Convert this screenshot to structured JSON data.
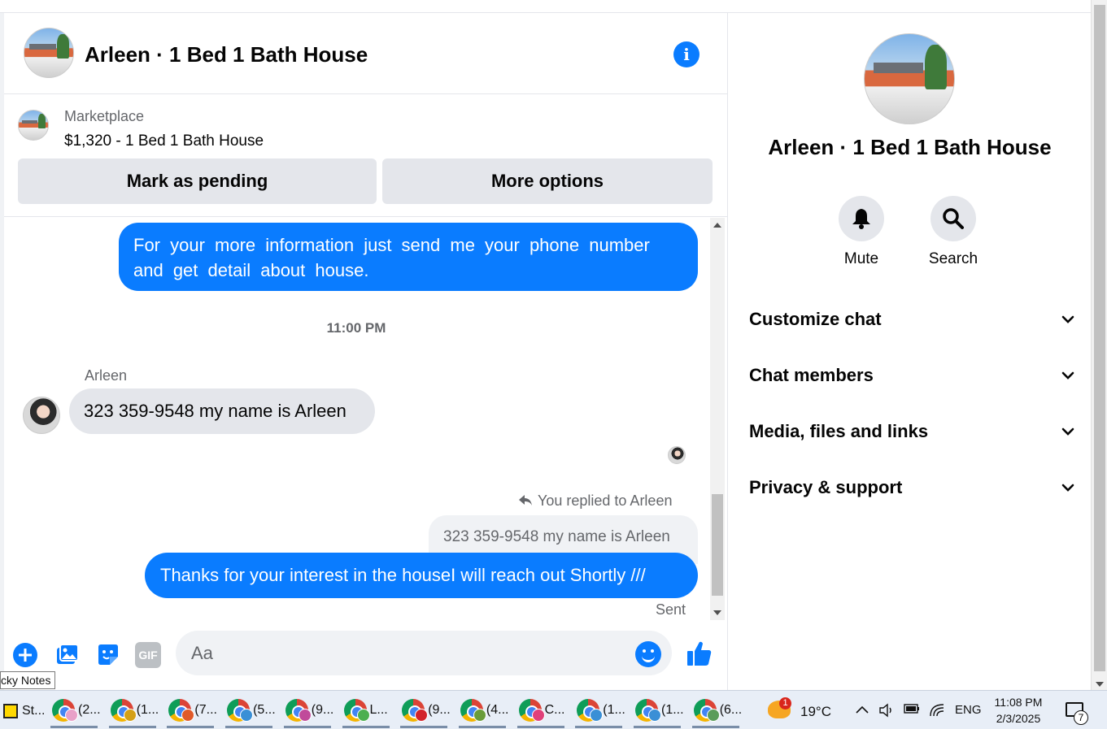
{
  "conversation": {
    "title": "Arleen · 1 Bed 1 Bath House"
  },
  "listing": {
    "label": "Marketplace",
    "title": "$1,320 - 1 Bed 1 Bath House",
    "pending_button": "Mark as pending",
    "more_button": "More options"
  },
  "messages": {
    "outgoing_1": "For your more information just send me  your phone number  and get detail about house.",
    "timestamp": "11:00 PM",
    "sender_name": "Arleen",
    "incoming_1": "323 359-9548 my name is Arleen",
    "reply_note": "You replied to Arleen",
    "quoted_text": "323 359-9548 my name is Arleen",
    "outgoing_2": "Thanks for your interest in the houseI will reach out Shortly ///",
    "status": "Sent"
  },
  "composer": {
    "placeholder": "Aa",
    "gif_label": "GIF"
  },
  "info_panel": {
    "title": "Arleen · 1 Bed 1 Bath House",
    "mute_label": "Mute",
    "search_label": "Search",
    "sections": [
      {
        "label": "Customize chat"
      },
      {
        "label": "Chat members"
      },
      {
        "label": "Media, files and links"
      },
      {
        "label": "Privacy & support"
      }
    ]
  },
  "sticky_tab": "cky Notes",
  "taskbar": {
    "start_label": "St...",
    "items": [
      {
        "label": "(2...",
        "badge": "#e8a0c8"
      },
      {
        "label": "(1...",
        "badge": "#d4a017"
      },
      {
        "label": "(7...",
        "badge": "#e05a2a"
      },
      {
        "label": "(5...",
        "badge": "#3a8fd6"
      },
      {
        "label": "(9...",
        "badge": "#c04a9a"
      },
      {
        "label": "L...",
        "badge": "#4caf50"
      },
      {
        "label": "(9...",
        "badge": "#d2232a"
      },
      {
        "label": "(4...",
        "badge": "#6a9c3a"
      },
      {
        "label": "C...",
        "badge": "#e0407a"
      },
      {
        "label": "(1...",
        "badge": "#3a8fd6"
      },
      {
        "label": "(1...",
        "badge": "#3a8fd6"
      },
      {
        "label": "(6...",
        "badge": "#5a9c5a"
      }
    ],
    "weather_badge": "1",
    "temperature": "19°C",
    "language": "ENG",
    "time": "11:08 PM",
    "date": "2/3/2025",
    "notification_count": "7"
  },
  "colors": {
    "accent": "#0a7cff",
    "bubble_incoming": "#e4e6eb",
    "secondary_text": "#65676b"
  }
}
